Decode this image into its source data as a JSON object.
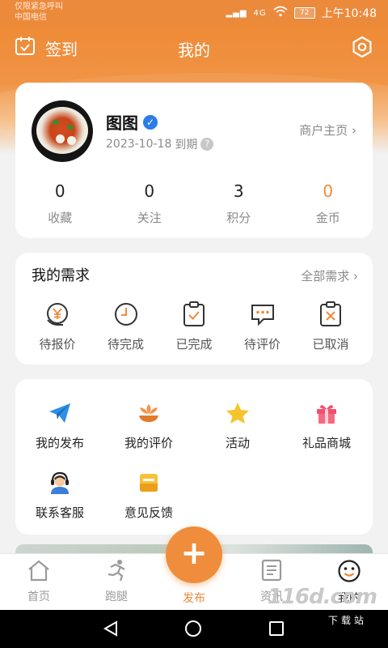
{
  "status_bar": {
    "left_line1": "仅限紧急呼叫",
    "left_line2": "中国电信",
    "network": "4G",
    "battery": "72",
    "time": "上午10:48"
  },
  "header": {
    "checkin_label": "签到",
    "title": "我的"
  },
  "profile": {
    "name": "图图",
    "expire_date": "2023-10-18",
    "expire_suffix": "到期",
    "qmark": "?",
    "merchant_link": "商户主页 ›",
    "stats": [
      {
        "value": "0",
        "label": "收藏"
      },
      {
        "value": "0",
        "label": "关注"
      },
      {
        "value": "3",
        "label": "积分"
      },
      {
        "value": "0",
        "label": "金币"
      }
    ]
  },
  "needs": {
    "title": "我的需求",
    "all_link": "全部需求 ›",
    "items": [
      {
        "label": "待报价",
        "icon": "quote-pending-icon"
      },
      {
        "label": "待完成",
        "icon": "clock-icon"
      },
      {
        "label": "已完成",
        "icon": "clipboard-check-icon"
      },
      {
        "label": "待评价",
        "icon": "comment-icon"
      },
      {
        "label": "已取消",
        "icon": "clipboard-cancel-icon"
      }
    ]
  },
  "services": {
    "items": [
      {
        "label": "我的发布",
        "icon": "paper-plane-icon"
      },
      {
        "label": "我的评价",
        "icon": "flower-icon"
      },
      {
        "label": "活动",
        "icon": "star-icon"
      },
      {
        "label": "礼品商城",
        "icon": "gift-icon"
      },
      {
        "label": "联系客服",
        "icon": "support-agent-icon"
      },
      {
        "label": "意见反馈",
        "icon": "feedback-envelope-icon"
      }
    ]
  },
  "tabbar": {
    "tabs": [
      {
        "label": "首页"
      },
      {
        "label": "跑腿"
      },
      {
        "label": "发布"
      },
      {
        "label": "资讯"
      },
      {
        "label": "我的"
      }
    ],
    "publish_symbol": "+"
  },
  "watermark": {
    "text": "116d.com",
    "sub": "下载站"
  },
  "colors": {
    "accent": "#ef8a3a",
    "verified": "#2b7de9",
    "gift": "#f0506e",
    "star": "#f5c42c"
  }
}
